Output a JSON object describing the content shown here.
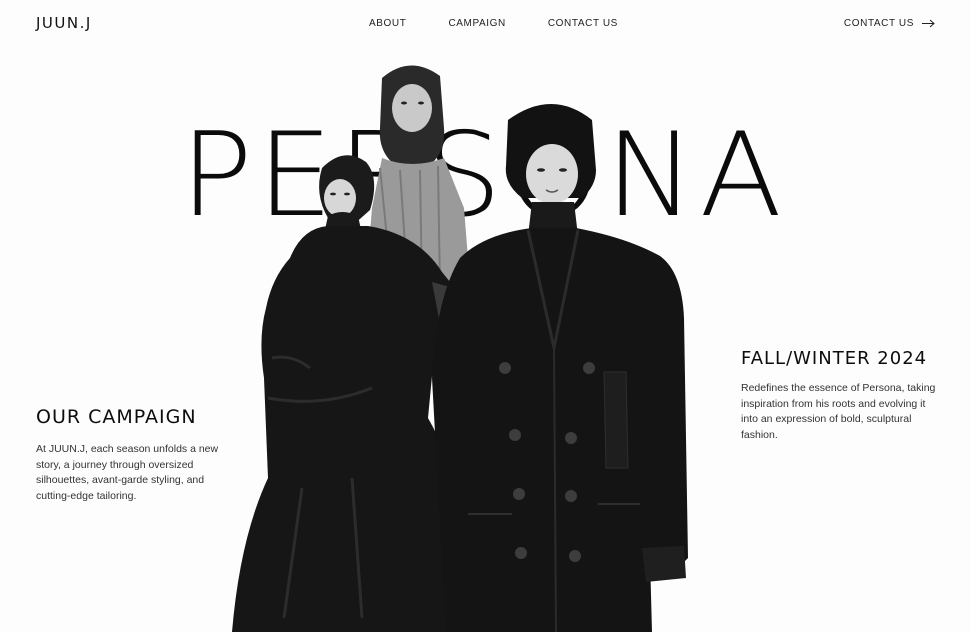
{
  "header": {
    "logo": "JUUN.J",
    "nav": [
      "ABOUT",
      "CAMPAIGN",
      "CONTACT US"
    ],
    "cta_label": "CONTACT US"
  },
  "hero": {
    "title": "PERSONA"
  },
  "campaign": {
    "heading": "OUR CAMPAIGN",
    "body": "At JUUN.J, each season unfolds a new story, a journey through oversized silhouettes, avant-garde styling, and cutting-edge tailoring."
  },
  "season": {
    "heading": "FALL/WINTER 2024",
    "body": "Redefines the essence of Persona, taking inspiration from his roots and evolving it into an expression of bold, sculptural fashion."
  },
  "icons": {
    "cta_arrow": "arrow-right-icon"
  },
  "colors": {
    "background": "#fdfdfd",
    "text": "#111111",
    "garment": "#141414"
  }
}
